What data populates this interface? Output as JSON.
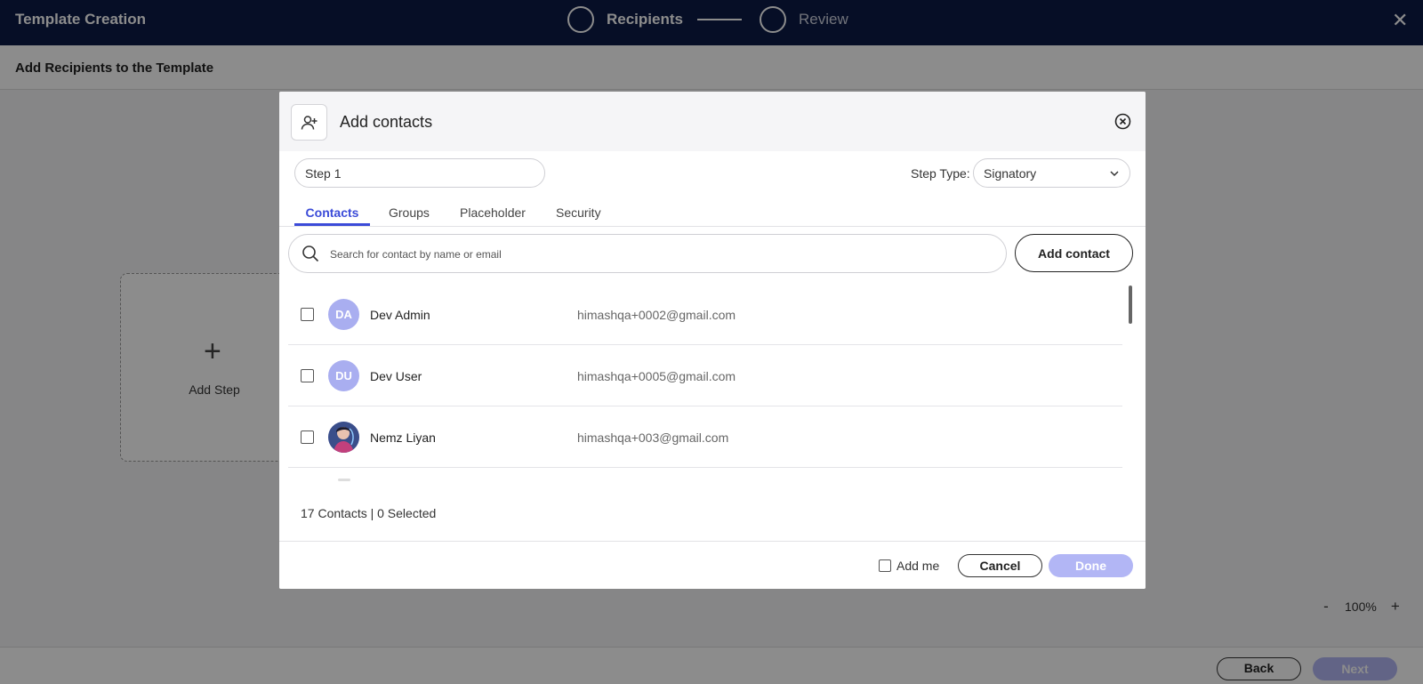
{
  "app": {
    "title": "Template Creation",
    "close_icon": "close-icon"
  },
  "stepper": {
    "steps": [
      {
        "label": "Recipients",
        "state": "active"
      },
      {
        "label": "Review",
        "state": "inactive"
      }
    ]
  },
  "page": {
    "subtitle": "Add Recipients to the Template",
    "add_step_label": "Add Step",
    "add_step_icon": "plus-icon"
  },
  "zoom": {
    "minus": "-",
    "level": "100%",
    "plus": "+"
  },
  "footer": {
    "back_label": "Back",
    "next_label": "Next"
  },
  "modal": {
    "title": "Add contacts",
    "header_icon": "add-user-icon",
    "close_icon": "close-circle-icon",
    "step_name_value": "Step 1",
    "step_type_label": "Step Type:",
    "step_type_value": "Signatory",
    "tabs": [
      {
        "label": "Contacts",
        "active": true
      },
      {
        "label": "Groups",
        "active": false
      },
      {
        "label": "Placeholder",
        "active": false
      },
      {
        "label": "Security",
        "active": false
      }
    ],
    "search_placeholder": "Search for contact by name or email",
    "add_contact_label": "Add contact",
    "contacts": [
      {
        "initials": "DA",
        "name": "Dev Admin",
        "email": "himashqa+0002@gmail.com",
        "checked": false,
        "photo": false
      },
      {
        "initials": "DU",
        "name": "Dev User",
        "email": "himashqa+0005@gmail.com",
        "checked": false,
        "photo": false
      },
      {
        "initials": "",
        "name": "Nemz Liyan",
        "email": "himashqa+003@gmail.com",
        "checked": false,
        "photo": true
      }
    ],
    "count_text": "17 Contacts | 0 Selected",
    "add_me_label": "Add me",
    "cancel_label": "Cancel",
    "done_label": "Done"
  },
  "colors": {
    "topbar": "#0b1a46",
    "accent": "#3b4bd8",
    "avatar": "#a9aef0",
    "disabled_button": "#b2b6f5"
  }
}
